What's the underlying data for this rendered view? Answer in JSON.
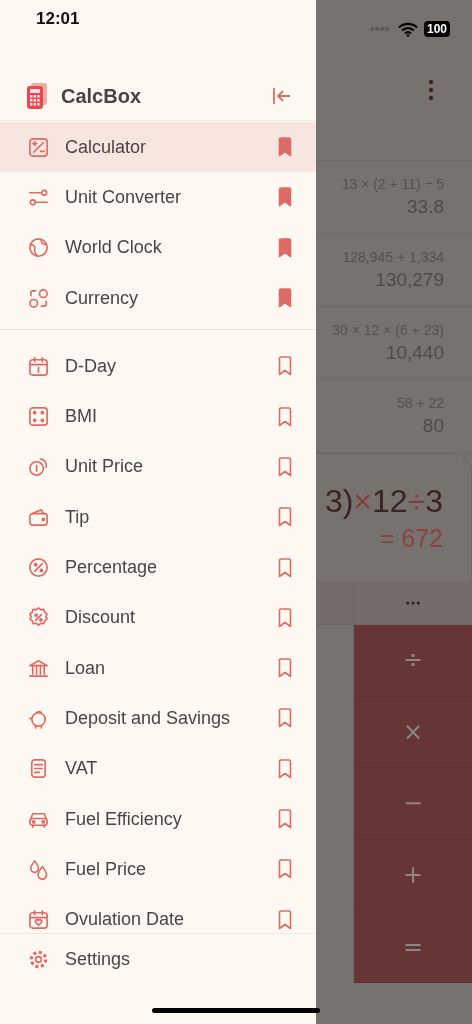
{
  "status_bar": {
    "time": "12:01",
    "battery": "100"
  },
  "background_app": {
    "history": [
      {
        "expression": "13 × (2 + 11) ÷ 5",
        "result": "33.8"
      },
      {
        "expression": "128,945 + 1,334",
        "result": "130,279"
      },
      {
        "expression": "30 × 12 × (6 + 23)",
        "result": "10,440"
      },
      {
        "expression": "58 + 22",
        "result": "80"
      }
    ],
    "display": {
      "tokens": [
        {
          "text": "3)",
          "kind": "number"
        },
        {
          "text": "×",
          "kind": "operator"
        },
        {
          "text": "12",
          "kind": "number"
        },
        {
          "text": "÷",
          "kind": "operator"
        },
        {
          "text": "3",
          "kind": "number"
        }
      ],
      "result": "= 672"
    },
    "keys": [
      "÷",
      "×",
      "−",
      "+",
      "="
    ]
  },
  "drawer": {
    "title": "CalcBox",
    "sections": [
      {
        "items": [
          {
            "label": "Calculator",
            "kind": "percent-square",
            "selected": true,
            "bookmarked": true
          },
          {
            "label": "Unit Converter",
            "kind": "sliders",
            "selected": false,
            "bookmarked": true
          },
          {
            "label": "World Clock",
            "kind": "globe",
            "selected": false,
            "bookmarked": true
          },
          {
            "label": "Currency",
            "kind": "exchange",
            "selected": false,
            "bookmarked": true
          }
        ]
      },
      {
        "items": [
          {
            "label": "D-Day",
            "kind": "calendar",
            "selected": false,
            "bookmarked": false
          },
          {
            "label": "BMI",
            "kind": "dice",
            "selected": false,
            "bookmarked": false
          },
          {
            "label": "Unit Price",
            "kind": "coin",
            "selected": false,
            "bookmarked": false
          },
          {
            "label": "Tip",
            "kind": "wallet",
            "selected": false,
            "bookmarked": false
          },
          {
            "label": "Percentage",
            "kind": "percent-circle",
            "selected": false,
            "bookmarked": false
          },
          {
            "label": "Discount",
            "kind": "badge",
            "selected": false,
            "bookmarked": false
          },
          {
            "label": "Loan",
            "kind": "bank",
            "selected": false,
            "bookmarked": false
          },
          {
            "label": "Deposit and Savings",
            "kind": "piggy",
            "selected": false,
            "bookmarked": false
          },
          {
            "label": "VAT",
            "kind": "receipt",
            "selected": false,
            "bookmarked": false
          },
          {
            "label": "Fuel Efficiency",
            "kind": "car",
            "selected": false,
            "bookmarked": false
          },
          {
            "label": "Fuel Price",
            "kind": "drops",
            "selected": false,
            "bookmarked": false
          },
          {
            "label": "Ovulation Date",
            "kind": "calendar-heart",
            "selected": false,
            "bookmarked": false
          }
        ]
      }
    ],
    "footer": {
      "label": "Settings",
      "kind": "gear"
    }
  }
}
